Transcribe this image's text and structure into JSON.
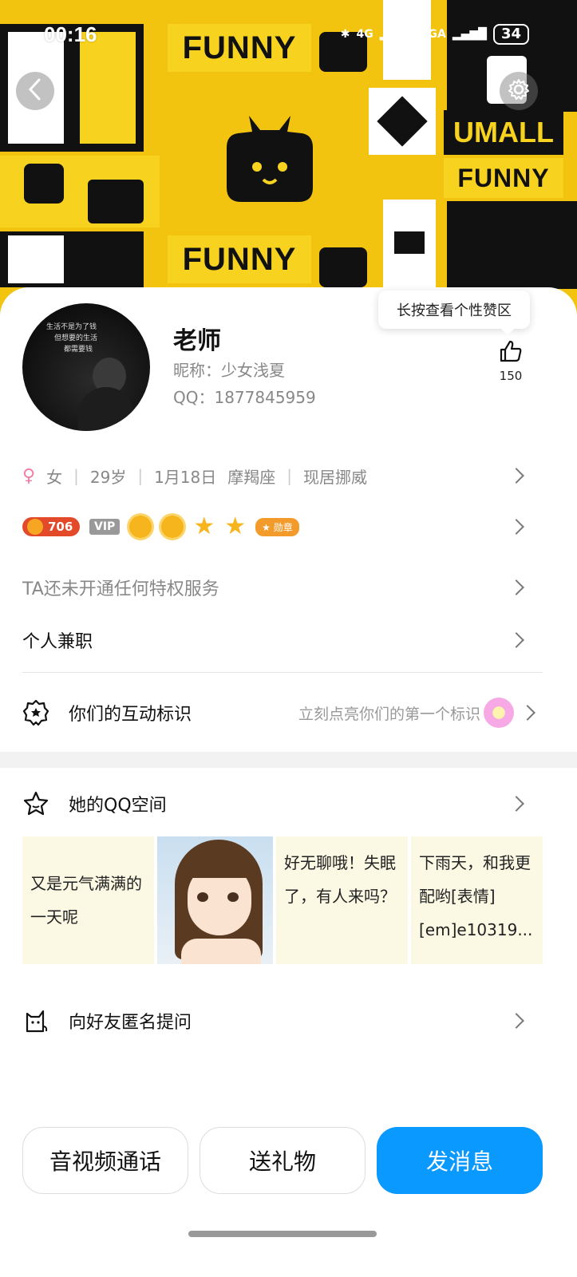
{
  "status_bar": {
    "time": "00:16",
    "network_1": "4G",
    "network_2": "5GA",
    "battery": "34"
  },
  "banner": {
    "texts": [
      "FUNNY",
      "FUNNY",
      "UMALL",
      "FUNNY"
    ]
  },
  "tooltip": "长按查看个性赞区",
  "profile": {
    "name": "老师",
    "nickname": "昵称：少女浅夏",
    "qq": "QQ：1877845959",
    "avatar_text_1": "生活不是为了钱",
    "avatar_text_2": "但想要的生活",
    "avatar_text_3": "都需要钱",
    "likes": "150"
  },
  "info": {
    "gender": "女",
    "age": "29岁",
    "birthday": "1月18日",
    "zodiac": "摩羯座",
    "location": "现居挪威"
  },
  "badges": {
    "coin": "706",
    "vip": "VIP",
    "medal": "勋章"
  },
  "rows": {
    "privilege": "TA还未开通任何特权服务",
    "parttime": "个人兼职",
    "interaction_title": "你们的互动标识",
    "interaction_hint": "立刻点亮你们的第一个标识",
    "qzone": "她的QQ空间",
    "ask": "向好友匿名提问"
  },
  "qzone_posts": [
    "又是元气满满的一天呢",
    "好无聊哦！失眠了，有人来吗？",
    "下雨天，和我更配哟[表情][em]e10319..."
  ],
  "buttons": {
    "call": "音视频通话",
    "gift": "送礼物",
    "message": "发消息"
  },
  "colors": {
    "banner": "#f2c40f",
    "primary": "#0a99ff",
    "coin": "#e34a2a"
  }
}
